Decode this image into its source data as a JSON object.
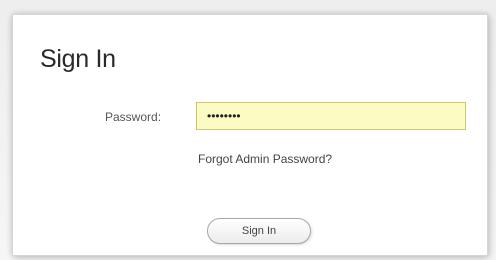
{
  "page": {
    "title": "Sign In"
  },
  "form": {
    "password_label": "Password:",
    "password_value": "********",
    "forgot_link": "Forgot Admin Password?",
    "signin_button": "Sign In"
  },
  "colors": {
    "input_background": "#fbfbc3",
    "panel_background": "#ffffff"
  }
}
